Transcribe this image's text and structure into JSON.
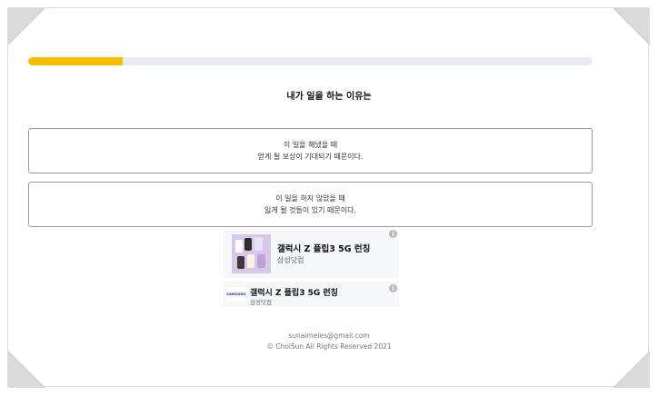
{
  "progress": {
    "value": 0.167,
    "color": "#f6bc00"
  },
  "question": "내가 일을 하는 이유는",
  "answers": [
    {
      "line1": "이 일을 해냈을 때",
      "line2": "얻게 될 보상이 기대되기 때문이다."
    },
    {
      "line1": "이 일을 하지 않았을 때",
      "line2": "잃게 될 것들이 있기 때문이다."
    }
  ],
  "ads": [
    {
      "title": "갤럭시 Z 플립3 5G 런칭",
      "advertiser": "삼성닷컴",
      "info_icon": "info-icon",
      "image": "phones-image"
    },
    {
      "title": "갤럭시 Z 플립3 5G 런칭",
      "advertiser": "삼성닷컴",
      "info_icon": "info-icon",
      "logo_text": "SAMSUNG"
    }
  ],
  "footer": {
    "email": "sunaimeles@gmail.com",
    "copyright": "© ChoiSun All Rights Reserved 2021"
  }
}
